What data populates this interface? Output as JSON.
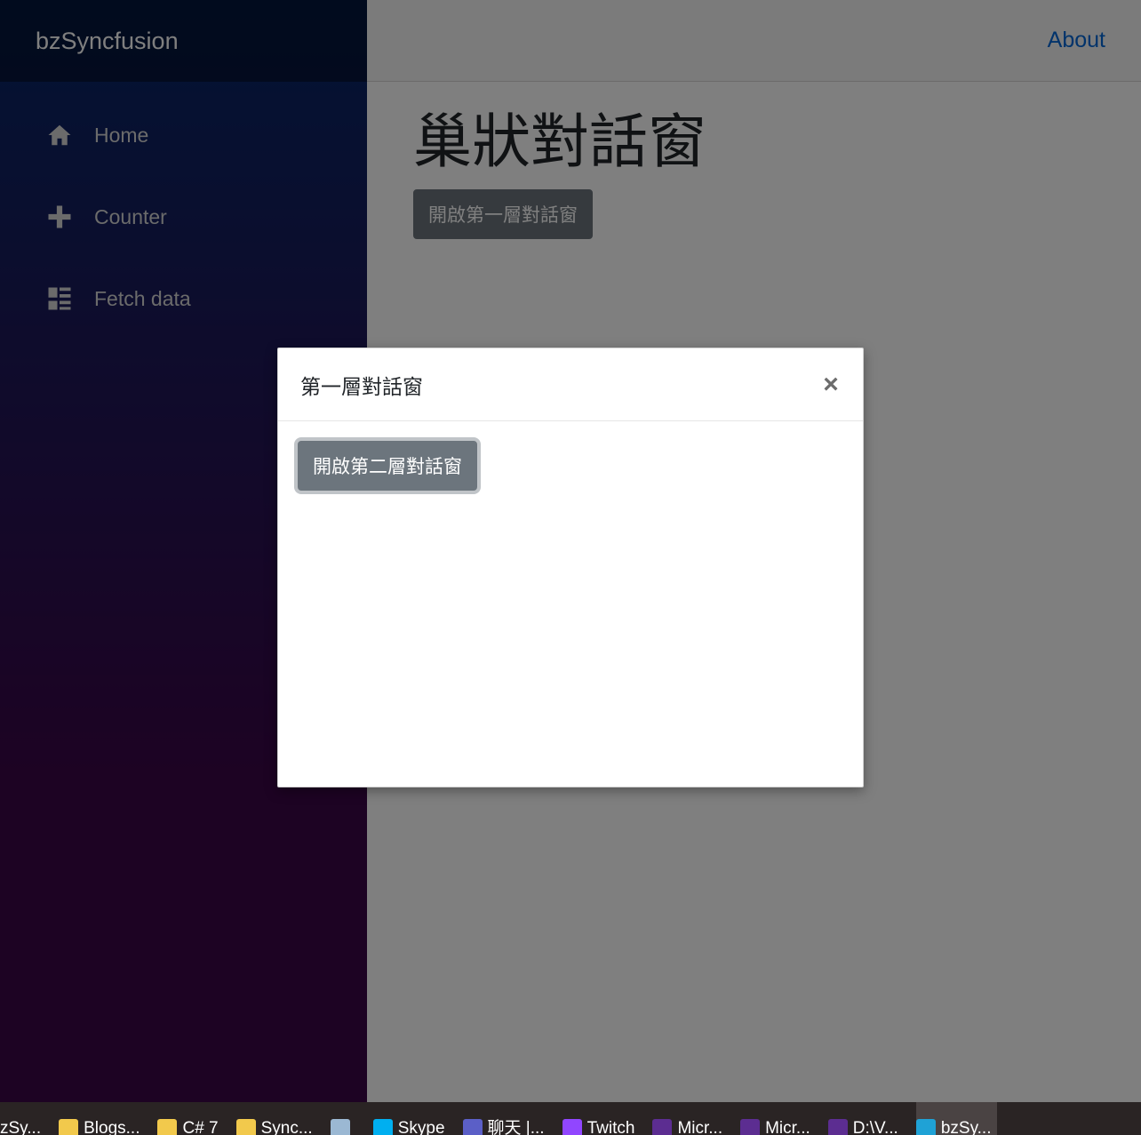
{
  "app": {
    "brand": "bzSyncfusion"
  },
  "sidebar": {
    "items": [
      {
        "label": "Home",
        "icon": "home-icon"
      },
      {
        "label": "Counter",
        "icon": "plus-icon"
      },
      {
        "label": "Fetch data",
        "icon": "list-icon"
      }
    ]
  },
  "header": {
    "about": "About"
  },
  "main": {
    "title": "巢狀對話窗",
    "open_first_button": "開啟第一層對話窗"
  },
  "dialog": {
    "title": "第一層對話窗",
    "close_glyph": "×",
    "open_second_button": "開啟第二層對話窗"
  },
  "taskbar": {
    "items": [
      {
        "label": "zSy...",
        "icon": "browser-icon",
        "color": "#3a7bd5"
      },
      {
        "label": "Blogs...",
        "icon": "folder-icon",
        "color": "#f2c94c"
      },
      {
        "label": "C# 7",
        "icon": "folder-icon",
        "color": "#f2c94c"
      },
      {
        "label": "Sync...",
        "icon": "folder-icon",
        "color": "#f2c94c"
      },
      {
        "label": "",
        "icon": "performance-icon",
        "color": "#9bb8d3"
      },
      {
        "label": "Skype",
        "icon": "skype-icon",
        "color": "#00aff0"
      },
      {
        "label": "聊天 |...",
        "icon": "teams-icon",
        "color": "#5b5fc7"
      },
      {
        "label": "Twitch",
        "icon": "twitch-icon",
        "color": "#9146ff"
      },
      {
        "label": "Micr...",
        "icon": "terminal-icon",
        "color": "#5c2d91"
      },
      {
        "label": "Micr...",
        "icon": "terminal-icon",
        "color": "#5c2d91"
      },
      {
        "label": "D:\\V...",
        "icon": "terminal-icon",
        "color": "#5c2d91"
      },
      {
        "label": "bzSy...",
        "icon": "edge-icon",
        "color": "#1fa2d6",
        "active": true
      }
    ]
  }
}
